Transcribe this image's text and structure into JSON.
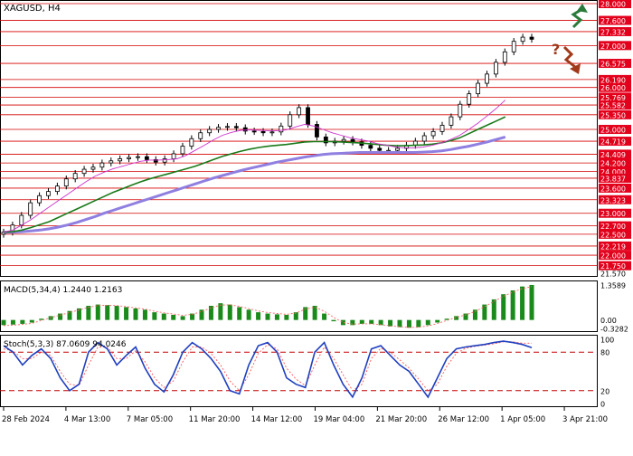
{
  "symbol_title": "XAGUSD, H4",
  "colors": {
    "price_candles": "#000000",
    "sma_fast": "#cc33cc",
    "sma_mid": "#1a7a1a",
    "sma_slow": "#8f7fe0",
    "level_line": "#d40000",
    "price_label_bg": "#e3001b",
    "price_label_text": "#ffffff",
    "macd_histogram": "#1a8a1a",
    "macd_signal": "#ff6666",
    "stoch_main": "#1f3fbf",
    "stoch_signal": "#ff5555",
    "stoch_levels": "#c40000",
    "arrow_up": "#2a7a3a",
    "arrow_down": "#a0391a",
    "question_mark": "#a0391a"
  },
  "chart_data": [
    {
      "panel": "price",
      "type": "candlestick",
      "title": "XAGUSD, H4",
      "ylim": [
        21.57,
        28.0
      ],
      "price_levels": [
        28.0,
        27.6,
        27.332,
        27.0,
        26.575,
        26.19,
        26.0,
        25.769,
        25.582,
        25.35,
        25.0,
        24.719,
        24.409,
        24.2,
        24.0,
        23.837,
        23.6,
        23.323,
        23.0,
        22.7,
        22.5,
        22.219,
        22.0,
        21.75
      ],
      "axis_labels": [
        "28.000",
        "27.600",
        "27.332",
        "27.000",
        "26.575",
        "26.190",
        "26.000",
        "25.769",
        "25.582",
        "25.350",
        "25.000",
        "24.719",
        "24.409",
        "24.200",
        "24.000",
        "23.837",
        "23.600",
        "23.323",
        "23.000",
        "22.700",
        "22.500",
        "22.219",
        "22.000",
        "21.750",
        "21.570"
      ],
      "close_series": [
        22.55,
        22.72,
        22.95,
        23.25,
        23.42,
        23.52,
        23.65,
        23.82,
        23.95,
        24.05,
        24.1,
        24.2,
        24.25,
        24.3,
        24.33,
        24.35,
        24.28,
        24.22,
        24.3,
        24.42,
        24.6,
        24.78,
        24.92,
        25.0,
        25.05,
        25.07,
        25.04,
        24.96,
        24.95,
        24.92,
        24.94,
        25.08,
        25.35,
        25.52,
        25.12,
        24.82,
        24.68,
        24.72,
        24.76,
        24.7,
        24.62,
        24.55,
        24.5,
        24.5,
        24.55,
        24.62,
        24.72,
        24.85,
        24.95,
        25.1,
        25.3,
        25.6,
        25.85,
        26.1,
        26.32,
        26.6,
        26.85,
        27.1,
        27.2,
        27.15
      ],
      "sma_fast": [
        22.55,
        22.6,
        22.72,
        22.85,
        23.0,
        23.15,
        23.3,
        23.45,
        23.6,
        23.75,
        23.88,
        23.98,
        24.06,
        24.12,
        24.18,
        24.24,
        24.27,
        24.27,
        24.28,
        24.3,
        24.38,
        24.5,
        24.62,
        24.75,
        24.86,
        24.93,
        24.98,
        24.99,
        24.98,
        24.97,
        24.97,
        24.99,
        25.06,
        25.12,
        25.08,
        25.0,
        24.92,
        24.86,
        24.8,
        24.76,
        24.72,
        24.66,
        24.62,
        24.58,
        24.56,
        24.56,
        24.58,
        24.62,
        24.68,
        24.76,
        24.86,
        25.0,
        25.15,
        25.32,
        25.5,
        25.7
      ],
      "sma_mid": [
        22.55,
        22.56,
        22.6,
        22.66,
        22.73,
        22.8,
        22.9,
        23.0,
        23.1,
        23.2,
        23.3,
        23.4,
        23.5,
        23.58,
        23.67,
        23.75,
        23.82,
        23.88,
        23.94,
        24.0,
        24.06,
        24.12,
        24.2,
        24.28,
        24.36,
        24.42,
        24.48,
        24.53,
        24.57,
        24.6,
        24.62,
        24.64,
        24.67,
        24.7,
        24.71,
        24.71,
        24.71,
        24.7,
        24.69,
        24.68,
        24.66,
        24.64,
        24.62,
        24.61,
        24.61,
        24.62,
        24.63,
        24.65,
        24.68,
        24.73,
        24.8,
        24.9,
        25.0,
        25.1,
        25.2,
        25.3
      ],
      "sma_slow": [
        22.55,
        22.55,
        22.56,
        22.58,
        22.6,
        22.63,
        22.67,
        22.72,
        22.78,
        22.85,
        22.92,
        23.0,
        23.07,
        23.14,
        23.21,
        23.28,
        23.35,
        23.42,
        23.49,
        23.56,
        23.63,
        23.7,
        23.77,
        23.84,
        23.9,
        23.96,
        24.02,
        24.07,
        24.12,
        24.17,
        24.22,
        24.26,
        24.3,
        24.34,
        24.37,
        24.4,
        24.42,
        24.43,
        24.44,
        24.45,
        24.45,
        24.45,
        24.45,
        24.45,
        24.45,
        24.45,
        24.46,
        24.47,
        24.49,
        24.52,
        24.56,
        24.6,
        24.65,
        24.7,
        24.76,
        24.82
      ]
    },
    {
      "panel": "macd",
      "type": "bar",
      "title": "MACD(5,34,4) 1.2440 1.2163",
      "ylim": [
        -0.3282,
        1.3589
      ],
      "axis_labels": [
        "1.3589",
        "0.00",
        "-0.3282"
      ],
      "histogram": [
        -0.2,
        -0.18,
        -0.15,
        -0.1,
        0.05,
        0.15,
        0.25,
        0.35,
        0.45,
        0.55,
        0.6,
        0.58,
        0.55,
        0.5,
        0.45,
        0.4,
        0.3,
        0.25,
        0.2,
        0.15,
        0.25,
        0.4,
        0.55,
        0.65,
        0.6,
        0.5,
        0.4,
        0.3,
        0.25,
        0.22,
        0.2,
        0.3,
        0.5,
        0.55,
        0.25,
        -0.05,
        -0.2,
        -0.2,
        -0.15,
        -0.15,
        -0.2,
        -0.25,
        -0.28,
        -0.3,
        -0.28,
        -0.2,
        -0.1,
        0.05,
        0.15,
        0.25,
        0.4,
        0.6,
        0.8,
        1.0,
        1.15,
        1.3,
        1.36
      ],
      "signal": [
        -0.22,
        -0.2,
        -0.17,
        -0.13,
        -0.02,
        0.09,
        0.19,
        0.29,
        0.39,
        0.49,
        0.56,
        0.57,
        0.56,
        0.52,
        0.47,
        0.42,
        0.34,
        0.28,
        0.23,
        0.18,
        0.22,
        0.33,
        0.47,
        0.58,
        0.59,
        0.53,
        0.44,
        0.35,
        0.29,
        0.25,
        0.22,
        0.27,
        0.42,
        0.5,
        0.34,
        0.1,
        -0.1,
        -0.16,
        -0.15,
        -0.15,
        -0.18,
        -0.23,
        -0.26,
        -0.29,
        -0.28,
        -0.23,
        -0.14,
        -0.02,
        0.1,
        0.2,
        0.33,
        0.52,
        0.72,
        0.92,
        1.08,
        1.22,
        1.3
      ]
    },
    {
      "panel": "stochastic",
      "type": "line",
      "title": "Stoch(5,3,3) 87.0609 94.0246",
      "ylim": [
        0,
        100
      ],
      "levels": [
        80,
        20
      ],
      "axis_labels": [
        "100",
        "80",
        "20",
        "0"
      ],
      "main": [
        90,
        80,
        60,
        75,
        85,
        70,
        40,
        20,
        30,
        80,
        95,
        85,
        60,
        75,
        88,
        55,
        30,
        18,
        45,
        80,
        95,
        85,
        70,
        50,
        20,
        15,
        60,
        90,
        95,
        80,
        40,
        30,
        25,
        80,
        95,
        60,
        30,
        10,
        40,
        85,
        90,
        75,
        60,
        50,
        30,
        10,
        40,
        70,
        85,
        88,
        90,
        92,
        95,
        97,
        95,
        92,
        87
      ],
      "signal": [
        85,
        82,
        70,
        70,
        80,
        75,
        50,
        30,
        28,
        60,
        88,
        88,
        70,
        70,
        82,
        65,
        40,
        25,
        35,
        65,
        88,
        88,
        78,
        60,
        35,
        20,
        45,
        78,
        92,
        85,
        55,
        38,
        28,
        60,
        88,
        70,
        45,
        20,
        30,
        70,
        86,
        80,
        68,
        55,
        38,
        20,
        30,
        58,
        78,
        86,
        89,
        91,
        93,
        96,
        96,
        94,
        94
      ]
    }
  ],
  "x_axis": {
    "labels": [
      "28 Feb 2024",
      "4 Mar 13:00",
      "7 Mar 05:00",
      "11 Mar 20:00",
      "14 Mar 12:00",
      "19 Mar 04:00",
      "21 Mar 20:00",
      "26 Mar 12:00",
      "1 Apr 05:00",
      "3 Apr 21:00"
    ]
  },
  "annotations": {
    "question_mark": "?"
  }
}
